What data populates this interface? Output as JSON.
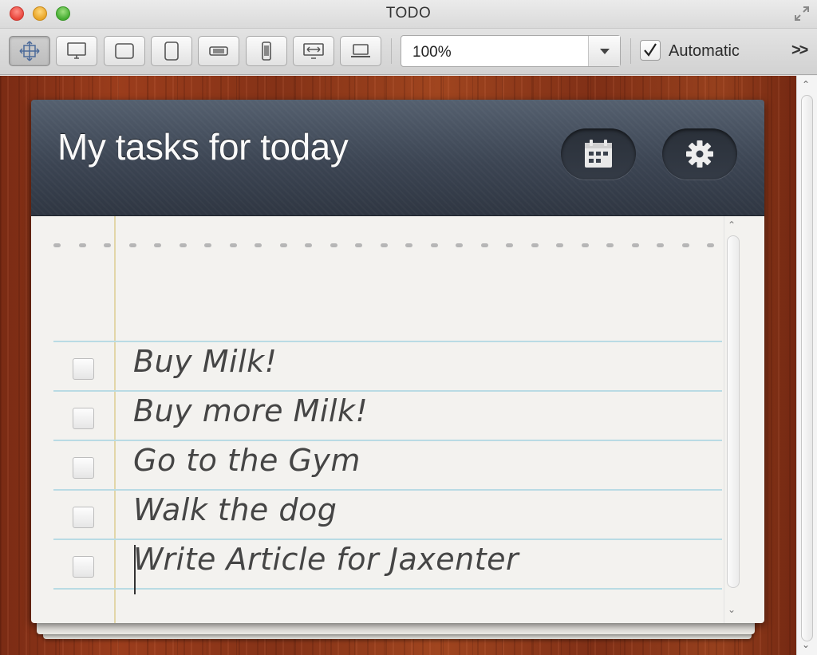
{
  "window": {
    "title": "TODO"
  },
  "toolbar": {
    "device_buttons": [
      {
        "icon": "fit-arrows-icon",
        "active": true
      },
      {
        "icon": "desktop-icon"
      },
      {
        "icon": "tablet-landscape-icon"
      },
      {
        "icon": "tablet-portrait-icon"
      },
      {
        "icon": "phone-landscape-icon"
      },
      {
        "icon": "phone-portrait-icon"
      },
      {
        "icon": "widescreen-icon"
      },
      {
        "icon": "laptop-icon"
      }
    ],
    "zoom_value": "100%",
    "automatic_label": "Automatic",
    "automatic_checked": true,
    "overflow_label": ">>"
  },
  "app": {
    "title": "My tasks for today",
    "header_buttons": [
      "calendar-icon",
      "gear-icon"
    ],
    "tasks": [
      {
        "label": "Buy Milk!",
        "done": false
      },
      {
        "label": "Buy more Milk!",
        "done": false
      },
      {
        "label": "Go to the Gym",
        "done": false
      },
      {
        "label": "Walk the dog",
        "done": false
      },
      {
        "label": "Write Article for Jaxenter",
        "done": false
      }
    ],
    "new_task_value": ""
  },
  "colors": {
    "header_bg": "#3c4553",
    "paper_bg": "#f3f2ef",
    "ruled_line": "#b9dbe4",
    "margin_line": "#e2d6a8",
    "wood": "#8a3518"
  }
}
